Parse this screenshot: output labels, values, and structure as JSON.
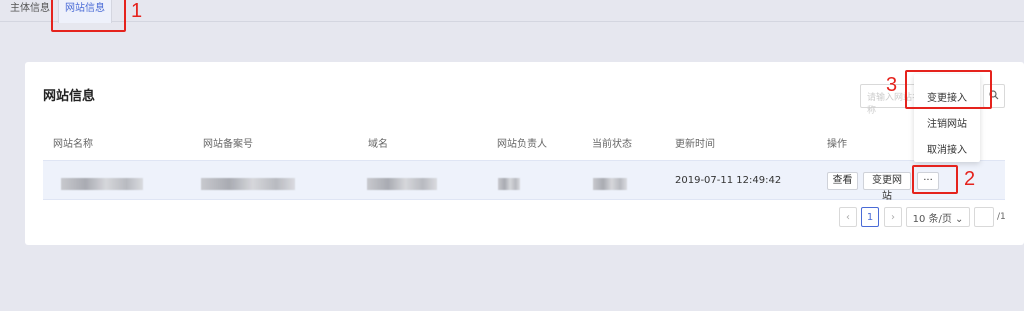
{
  "tabs": [
    {
      "label": "主体信息"
    },
    {
      "label": "网站信息"
    }
  ],
  "card": {
    "title": "网站信息",
    "search_placeholder": "请输入网站名称"
  },
  "table": {
    "headers": [
      "网站名称",
      "网站备案号",
      "域名",
      "网站负责人",
      "当前状态",
      "更新时间",
      "操作"
    ],
    "row": {
      "updated": "2019-07-11 12:49:42",
      "actions": {
        "view": "查看",
        "change_site": "变更网站",
        "more": "···"
      }
    }
  },
  "pagination": {
    "prev": "‹",
    "page": "1",
    "next": "›",
    "page_size": "10 条/页 ⌄",
    "total_suffix": "/1"
  },
  "dropdown": {
    "items": [
      "变更接入",
      "注销网站",
      "取消接入"
    ]
  },
  "annotations": {
    "labels": [
      "1",
      "2",
      "3"
    ],
    "color": "#e5231d"
  },
  "colors": {
    "accent": "#4a6bd6",
    "row_highlight": "#eef2fb",
    "background": "#e6e7ef"
  }
}
